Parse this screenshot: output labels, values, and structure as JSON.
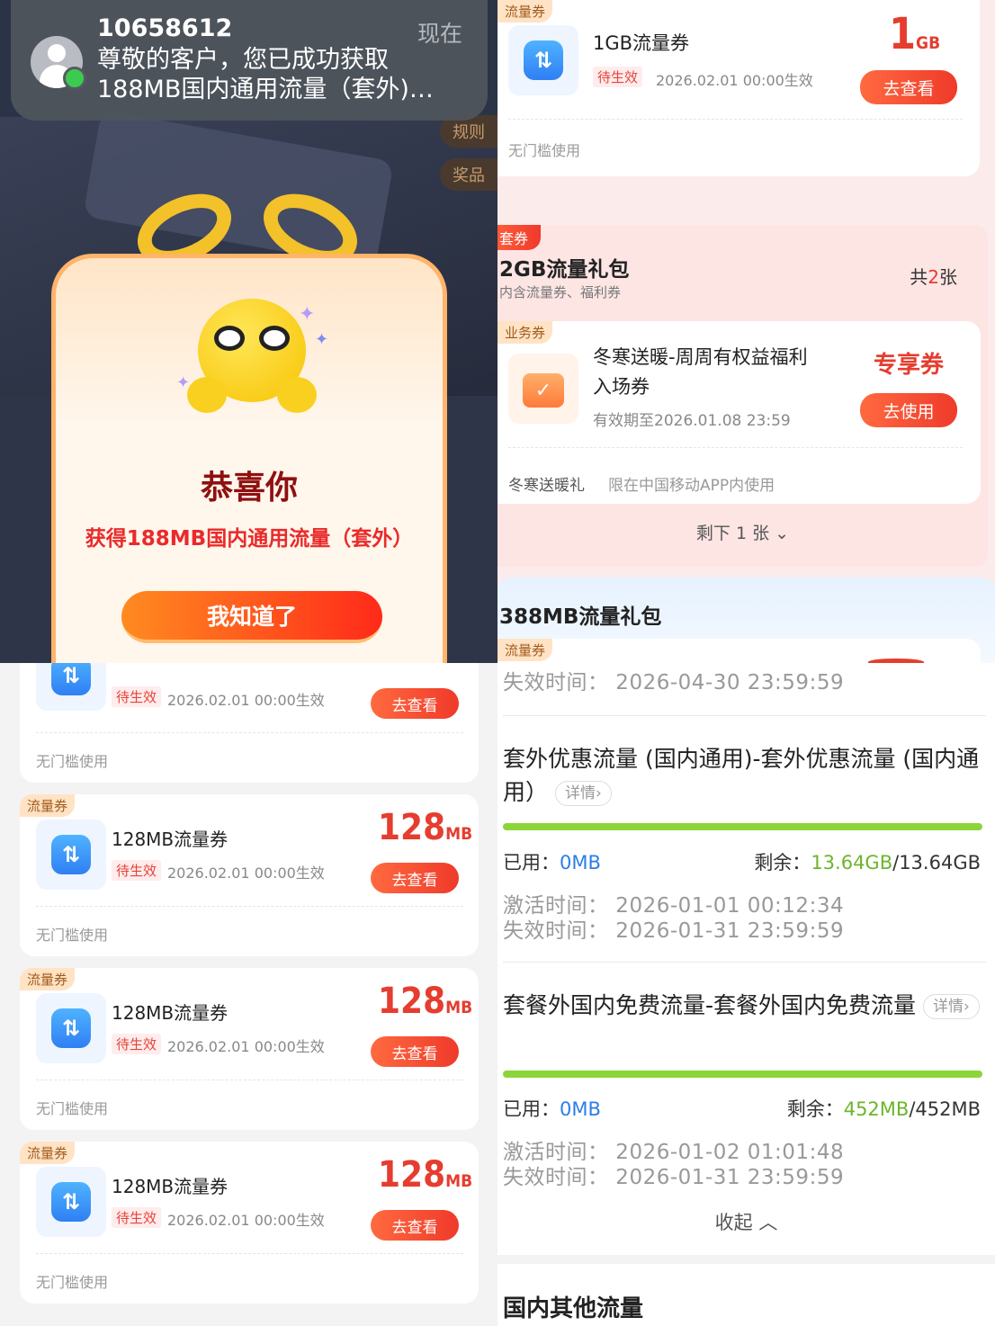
{
  "notification": {
    "sender": "10658612",
    "time": "现在",
    "body": "尊敬的客户，您已成功获取188MB国内通用流量（套外)…"
  },
  "background": {
    "side_rule": "规则",
    "side_prize": "奖品"
  },
  "popup": {
    "title": "恭喜你",
    "subtitle": "获得188MB国内通用流量（套外）",
    "button": "我知道了"
  },
  "top_coupon": {
    "tag": "流量券",
    "name": "1GB流量券",
    "status": "待生效",
    "date": "2026.02.01 00:00生效",
    "amount": "1",
    "unit": "GB",
    "button": "去查看",
    "note": "无门槛使用"
  },
  "package_2gb": {
    "tag": "套券",
    "title": "2GB流量礼包",
    "subtitle": "内含流量券、福利券",
    "count_prefix": "共",
    "count_value": "2",
    "count_suffix": "张",
    "card": {
      "tag": "业务券",
      "name_line1": "冬寒送暖-周周有权益福利",
      "name_line2": "入场券",
      "validity": "有效期至2026.01.08 23:59",
      "label": "专享券",
      "button": "去使用",
      "note_title": "冬寒送暖礼",
      "note_text": "限在中国移动APP内使用"
    },
    "remain": "剩下 1 张"
  },
  "package_388": {
    "title": "388MB流量礼包",
    "tag": "流量券"
  },
  "coupon_list": {
    "first_partial": {
      "status": "待生效",
      "date": "2026.02.01 00:00生效",
      "button": "去查看",
      "note": "无门槛使用"
    },
    "items": [
      {
        "tag": "流量券",
        "name": "128MB流量券",
        "status": "待生效",
        "date": "2026.02.01 00:00生效",
        "amount": "128",
        "unit": "MB",
        "button": "去查看",
        "note": "无门槛使用"
      },
      {
        "tag": "流量券",
        "name": "128MB流量券",
        "status": "待生效",
        "date": "2026.02.01 00:00生效",
        "amount": "128",
        "unit": "MB",
        "button": "去查看",
        "note": "无门槛使用"
      },
      {
        "tag": "流量券",
        "name": "128MB流量券",
        "status": "待生效",
        "date": "2026.02.01 00:00生效",
        "amount": "128",
        "unit": "MB",
        "button": "去查看",
        "note": "无门槛使用"
      }
    ]
  },
  "usage": {
    "top_expire": "失效时间：  2026-04-30 23:59:59",
    "items": [
      {
        "title": "套外优惠流量 (国内通用)-套外优惠流量 (国内通用）",
        "detail": "详情",
        "used_label": "已用：",
        "used_value": "0MB",
        "remain_label": "剩余：",
        "remain_value": "13.64GB",
        "total": "/13.64GB",
        "remaining_fraction": 1.0,
        "activate": "激活时间：  2026-01-01 00:12:34",
        "expire": "失效时间：  2026-01-31 23:59:59"
      },
      {
        "title": "套餐外国内免费流量-套餐外国内免费流量",
        "detail": "详情",
        "used_label": "已用：",
        "used_value": "0MB",
        "remain_label": "剩余：",
        "remain_value": "452MB",
        "total": "/452MB",
        "remaining_fraction": 1.0,
        "activate": "激活时间：  2026-01-02 01:01:48",
        "expire": "失效时间：  2026-01-31 23:59:59"
      }
    ],
    "collapse": "收起",
    "other_title": "国内其他流量"
  },
  "colors": {
    "accent_red": "#e53d2f",
    "used_blue": "#2b7de9",
    "remain_green": "#6db52a",
    "bar_green": "#8bd53a"
  }
}
